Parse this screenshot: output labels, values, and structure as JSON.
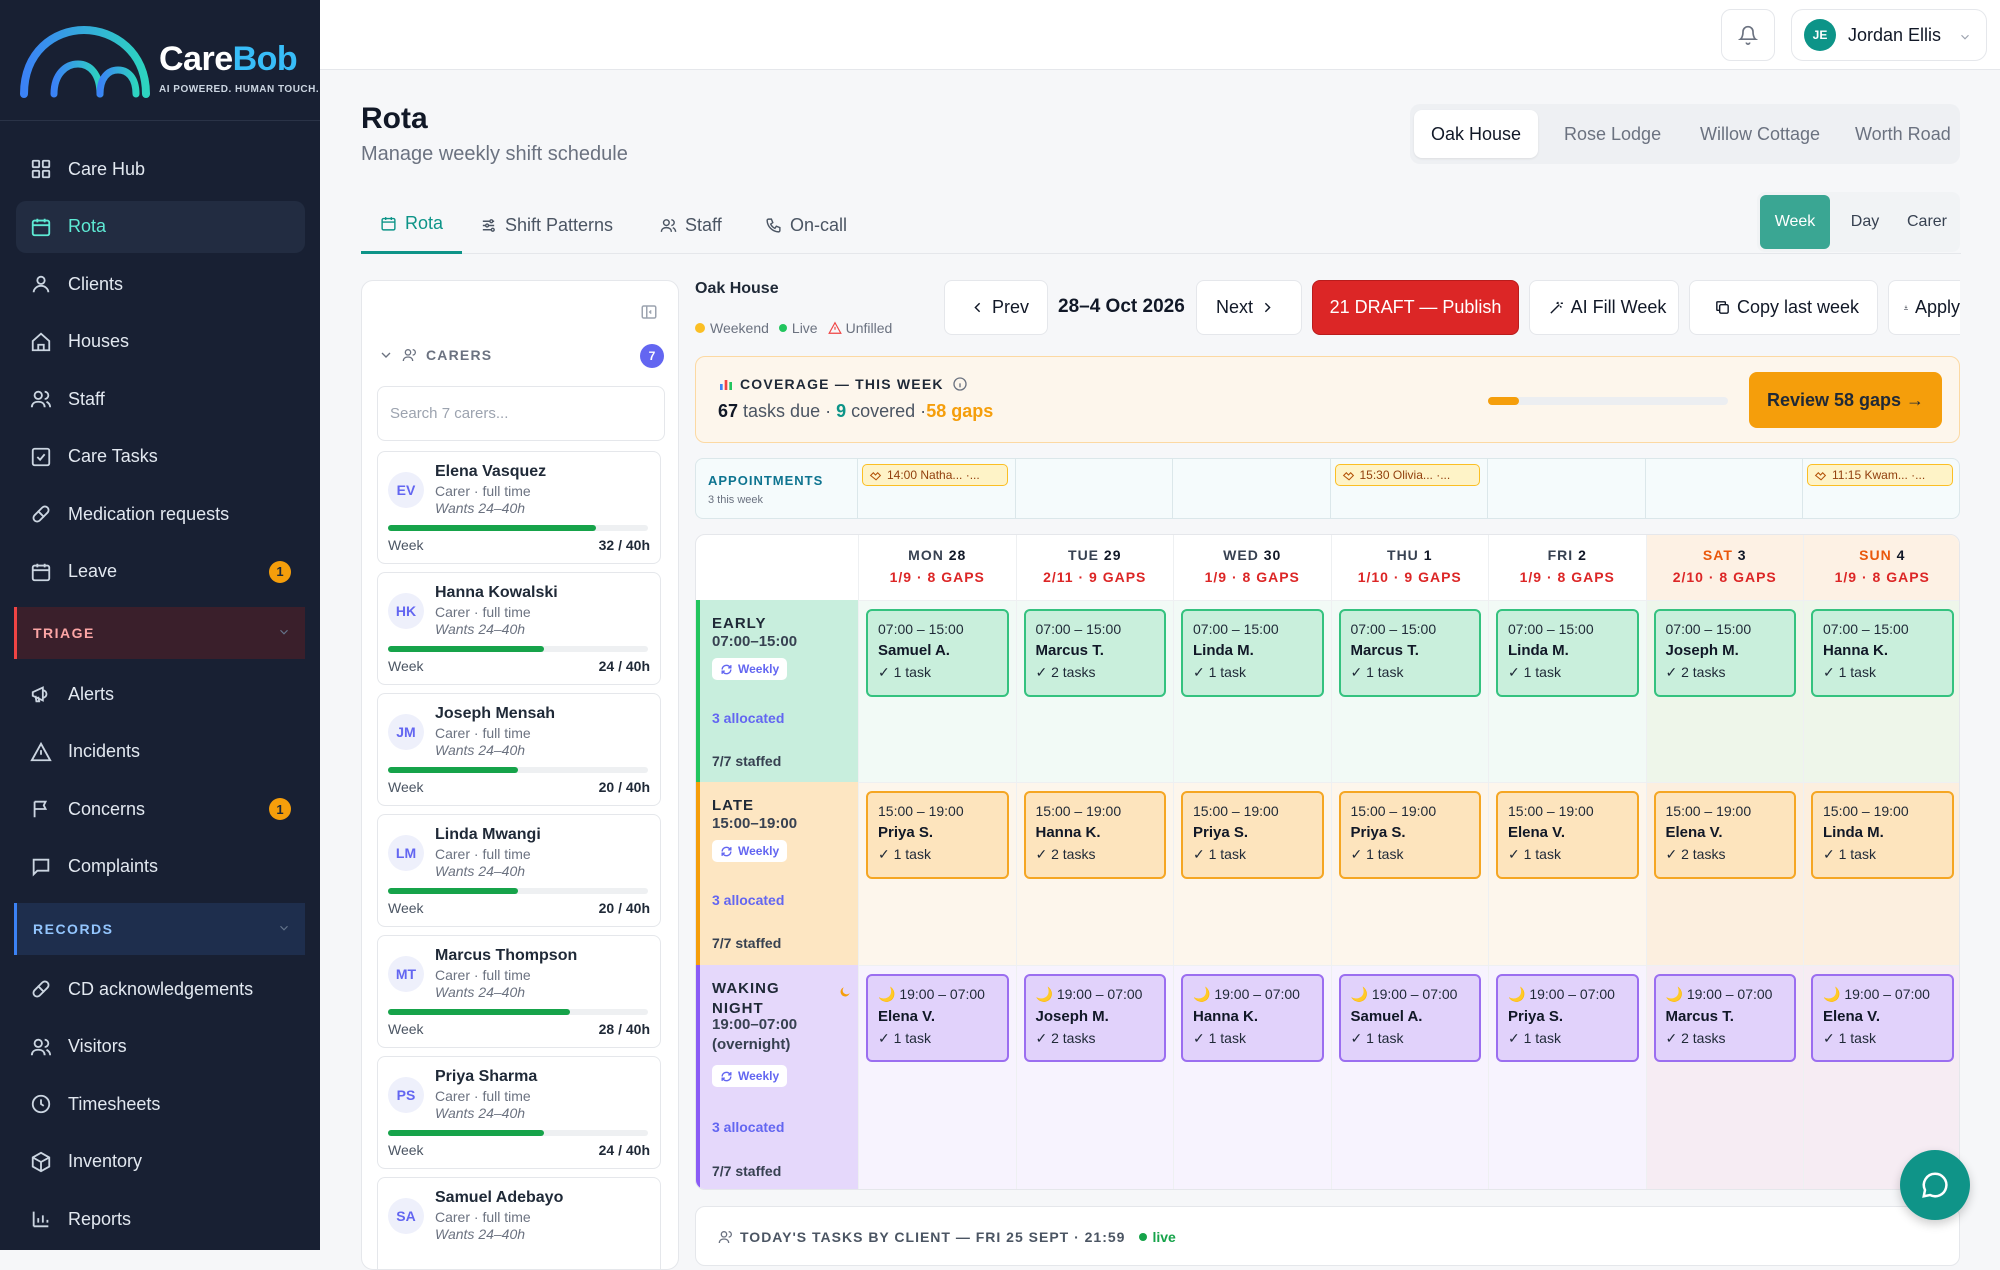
{
  "brand": {
    "name_a": "Care",
    "name_b": "Bob",
    "tagline": "AI POWERED. HUMAN TOUCH."
  },
  "nav": {
    "items": [
      {
        "label": "Care Hub",
        "icon": "grid-icon"
      },
      {
        "label": "Rota",
        "icon": "calendar-icon",
        "active": true
      },
      {
        "label": "Clients",
        "icon": "user-icon"
      },
      {
        "label": "Houses",
        "icon": "house-icon"
      },
      {
        "label": "Staff",
        "icon": "users-icon"
      },
      {
        "label": "Care Tasks",
        "icon": "checkbox-icon"
      },
      {
        "label": "Medication requests",
        "icon": "pill-icon"
      },
      {
        "label": "Leave",
        "icon": "calendar-icon",
        "badge": "1"
      }
    ],
    "triage_label": "TRIAGE",
    "triage_items": [
      {
        "label": "Alerts",
        "icon": "megaphone-icon"
      },
      {
        "label": "Incidents",
        "icon": "warning-icon"
      },
      {
        "label": "Concerns",
        "icon": "flag-icon",
        "badge": "1"
      },
      {
        "label": "Complaints",
        "icon": "message-icon"
      }
    ],
    "records_label": "RECORDS",
    "records_items": [
      {
        "label": "CD acknowledgements",
        "icon": "pill-icon"
      },
      {
        "label": "Visitors",
        "icon": "users-icon"
      },
      {
        "label": "Timesheets",
        "icon": "clock-icon"
      },
      {
        "label": "Inventory",
        "icon": "box-icon"
      },
      {
        "label": "Reports",
        "icon": "bar-chart-icon"
      }
    ]
  },
  "user": {
    "initials": "JE",
    "name": "Jordan Ellis"
  },
  "page": {
    "title": "Rota",
    "subtitle": "Manage weekly shift schedule"
  },
  "houses": [
    "Oak House",
    "Rose Lodge",
    "Willow Cottage",
    "Worth Road"
  ],
  "tabs": [
    "Rota",
    "Shift Patterns",
    "Staff",
    "On-call"
  ],
  "view_toggle": [
    "Week",
    "Day",
    "Carer"
  ],
  "carers": {
    "heading": "CARERS",
    "count": "7",
    "search_placeholder": "Search 7 carers...",
    "list": [
      {
        "initials": "EV",
        "name": "Elena Vasquez",
        "role": "Carer · full time",
        "wants": "Wants 24–40h",
        "week": "Week",
        "hours": "32 / 40h",
        "fill": 0.8
      },
      {
        "initials": "HK",
        "name": "Hanna Kowalski",
        "role": "Carer · full time",
        "wants": "Wants 24–40h",
        "week": "Week",
        "hours": "24 / 40h",
        "fill": 0.6
      },
      {
        "initials": "JM",
        "name": "Joseph Mensah",
        "role": "Carer · full time",
        "wants": "Wants 24–40h",
        "week": "Week",
        "hours": "20 / 40h",
        "fill": 0.5
      },
      {
        "initials": "LM",
        "name": "Linda Mwangi",
        "role": "Carer · full time",
        "wants": "Wants 24–40h",
        "week": "Week",
        "hours": "20 / 40h",
        "fill": 0.5
      },
      {
        "initials": "MT",
        "name": "Marcus Thompson",
        "role": "Carer · full time",
        "wants": "Wants 24–40h",
        "week": "Week",
        "hours": "28 / 40h",
        "fill": 0.7
      },
      {
        "initials": "PS",
        "name": "Priya Sharma",
        "role": "Carer · full time",
        "wants": "Wants 24–40h",
        "week": "Week",
        "hours": "24 / 40h",
        "fill": 0.6
      },
      {
        "initials": "SA",
        "name": "Samuel Adebayo",
        "role": "Carer · full time",
        "wants": "Wants 24–40h",
        "week": "",
        "hours": "",
        "fill": 0
      }
    ]
  },
  "schedule": {
    "location": "Oak House",
    "legend": {
      "weekend": "Weekend",
      "live": "Live",
      "unfilled": "Unfilled"
    },
    "prev": "Prev",
    "date_range": "28–4 Oct 2026",
    "next": "Next",
    "publish": "21 DRAFT — Publish",
    "ai_fill": "AI Fill Week",
    "copy": "Copy last week",
    "apply": "Apply"
  },
  "coverage": {
    "title": "COVERAGE — THIS WEEK",
    "tasks_due": "67",
    "tasks_due_label": "tasks due ·",
    "covered": "9",
    "covered_label": "covered ·",
    "gaps": "58 gaps",
    "progress": 0.13,
    "review": "Review 58 gaps →"
  },
  "appointments": {
    "title": "APPOINTMENTS",
    "sub": "3 this week",
    "chips": [
      {
        "day": 0,
        "text": "14:00 Natha... ·..."
      },
      {
        "day": 3,
        "text": "15:30 Olivia... ·..."
      },
      {
        "day": 6,
        "text": "11:15 Kwam... ·..."
      }
    ]
  },
  "days": [
    {
      "name": "MON",
      "num": "28",
      "gaps": "1/9 · 8 GAPS"
    },
    {
      "name": "TUE",
      "num": "29",
      "gaps": "2/11 · 9 GAPS"
    },
    {
      "name": "WED",
      "num": "30",
      "gaps": "1/9 · 8 GAPS"
    },
    {
      "name": "THU",
      "num": "1",
      "gaps": "1/10 · 9 GAPS"
    },
    {
      "name": "FRI",
      "num": "2",
      "gaps": "1/9 · 8 GAPS"
    },
    {
      "name": "SAT",
      "num": "3",
      "gaps": "2/10 · 8 GAPS",
      "weekend": true
    },
    {
      "name": "SUN",
      "num": "4",
      "gaps": "1/9 · 8 GAPS",
      "weekend": true
    }
  ],
  "shift_rows": [
    {
      "name": "EARLY",
      "time": "07:00–15:00",
      "weekly": "Weekly",
      "allocated": "3 allocated",
      "staffed": "7/7 staffed",
      "color": "#22c55e",
      "bg": "#c8eedd",
      "cell_bg": "#f2faf6",
      "weekend_bg": "#eef6ea",
      "card_bg": "#c9efdc",
      "card_border": "#34c27f",
      "shifts": [
        {
          "time": "07:00 – 15:00",
          "name": "Samuel A.",
          "tasks": "✓ 1 task"
        },
        {
          "time": "07:00 – 15:00",
          "name": "Marcus T.",
          "tasks": "✓ 2 tasks"
        },
        {
          "time": "07:00 – 15:00",
          "name": "Linda M.",
          "tasks": "✓ 1 task"
        },
        {
          "time": "07:00 – 15:00",
          "name": "Marcus T.",
          "tasks": "✓ 1 task"
        },
        {
          "time": "07:00 – 15:00",
          "name": "Linda M.",
          "tasks": "✓ 1 task"
        },
        {
          "time": "07:00 – 15:00",
          "name": "Joseph M.",
          "tasks": "✓ 2 tasks"
        },
        {
          "time": "07:00 – 15:00",
          "name": "Hanna K.",
          "tasks": "✓ 1 task"
        }
      ]
    },
    {
      "name": "LATE",
      "time": "15:00–19:00",
      "weekly": "Weekly",
      "allocated": "3 allocated",
      "staffed": "7/7 staffed",
      "color": "#f59e0b",
      "bg": "#fde6c2",
      "cell_bg": "#fdf6ec",
      "weekend_bg": "#fcefdf",
      "card_bg": "#fde4bd",
      "card_border": "#f5a623",
      "shifts": [
        {
          "time": "15:00 – 19:00",
          "name": "Priya S.",
          "tasks": "✓ 1 task"
        },
        {
          "time": "15:00 – 19:00",
          "name": "Hanna K.",
          "tasks": "✓ 2 tasks"
        },
        {
          "time": "15:00 – 19:00",
          "name": "Priya S.",
          "tasks": "✓ 1 task"
        },
        {
          "time": "15:00 – 19:00",
          "name": "Priya S.",
          "tasks": "✓ 1 task"
        },
        {
          "time": "15:00 – 19:00",
          "name": "Elena V.",
          "tasks": "✓ 1 task"
        },
        {
          "time": "15:00 – 19:00",
          "name": "Elena V.",
          "tasks": "✓ 2 tasks"
        },
        {
          "time": "15:00 – 19:00",
          "name": "Linda M.",
          "tasks": "✓ 1 task"
        }
      ]
    },
    {
      "name": "WAKING NIGHT",
      "time": "19:00–07:00 (overnight)",
      "weekly": "Weekly",
      "allocated": "3 allocated",
      "staffed": "7/7 staffed",
      "color": "#8b5cf6",
      "bg": "#e5d8fb",
      "cell_bg": "#f7f3fe",
      "weekend_bg": "#f6ecf3",
      "card_bg": "#e1d2fb",
      "card_border": "#9b6ef0",
      "shifts": [
        {
          "time": "🌙 19:00 – 07:00",
          "name": "Elena V.",
          "tasks": "✓ 1 task"
        },
        {
          "time": "🌙 19:00 – 07:00",
          "name": "Joseph M.",
          "tasks": "✓ 2 tasks"
        },
        {
          "time": "🌙 19:00 – 07:00",
          "name": "Hanna K.",
          "tasks": "✓ 1 task"
        },
        {
          "time": "🌙 19:00 – 07:00",
          "name": "Samuel A.",
          "tasks": "✓ 1 task"
        },
        {
          "time": "🌙 19:00 – 07:00",
          "name": "Priya S.",
          "tasks": "✓ 1 task"
        },
        {
          "time": "🌙 19:00 – 07:00",
          "name": "Marcus T.",
          "tasks": "✓ 2 tasks"
        },
        {
          "time": "🌙 19:00 – 07:00",
          "name": "Elena V.",
          "tasks": "✓ 1 task"
        }
      ]
    }
  ],
  "today": {
    "title": "TODAY'S TASKS BY CLIENT — FRI 25 SEPT · 21:59",
    "live": "live"
  },
  "colors": {
    "brand_teal": "#0d9488",
    "publish_red": "#dc2626",
    "gap_amber": "#f59e0b",
    "sidebar_bg": "#182033"
  }
}
